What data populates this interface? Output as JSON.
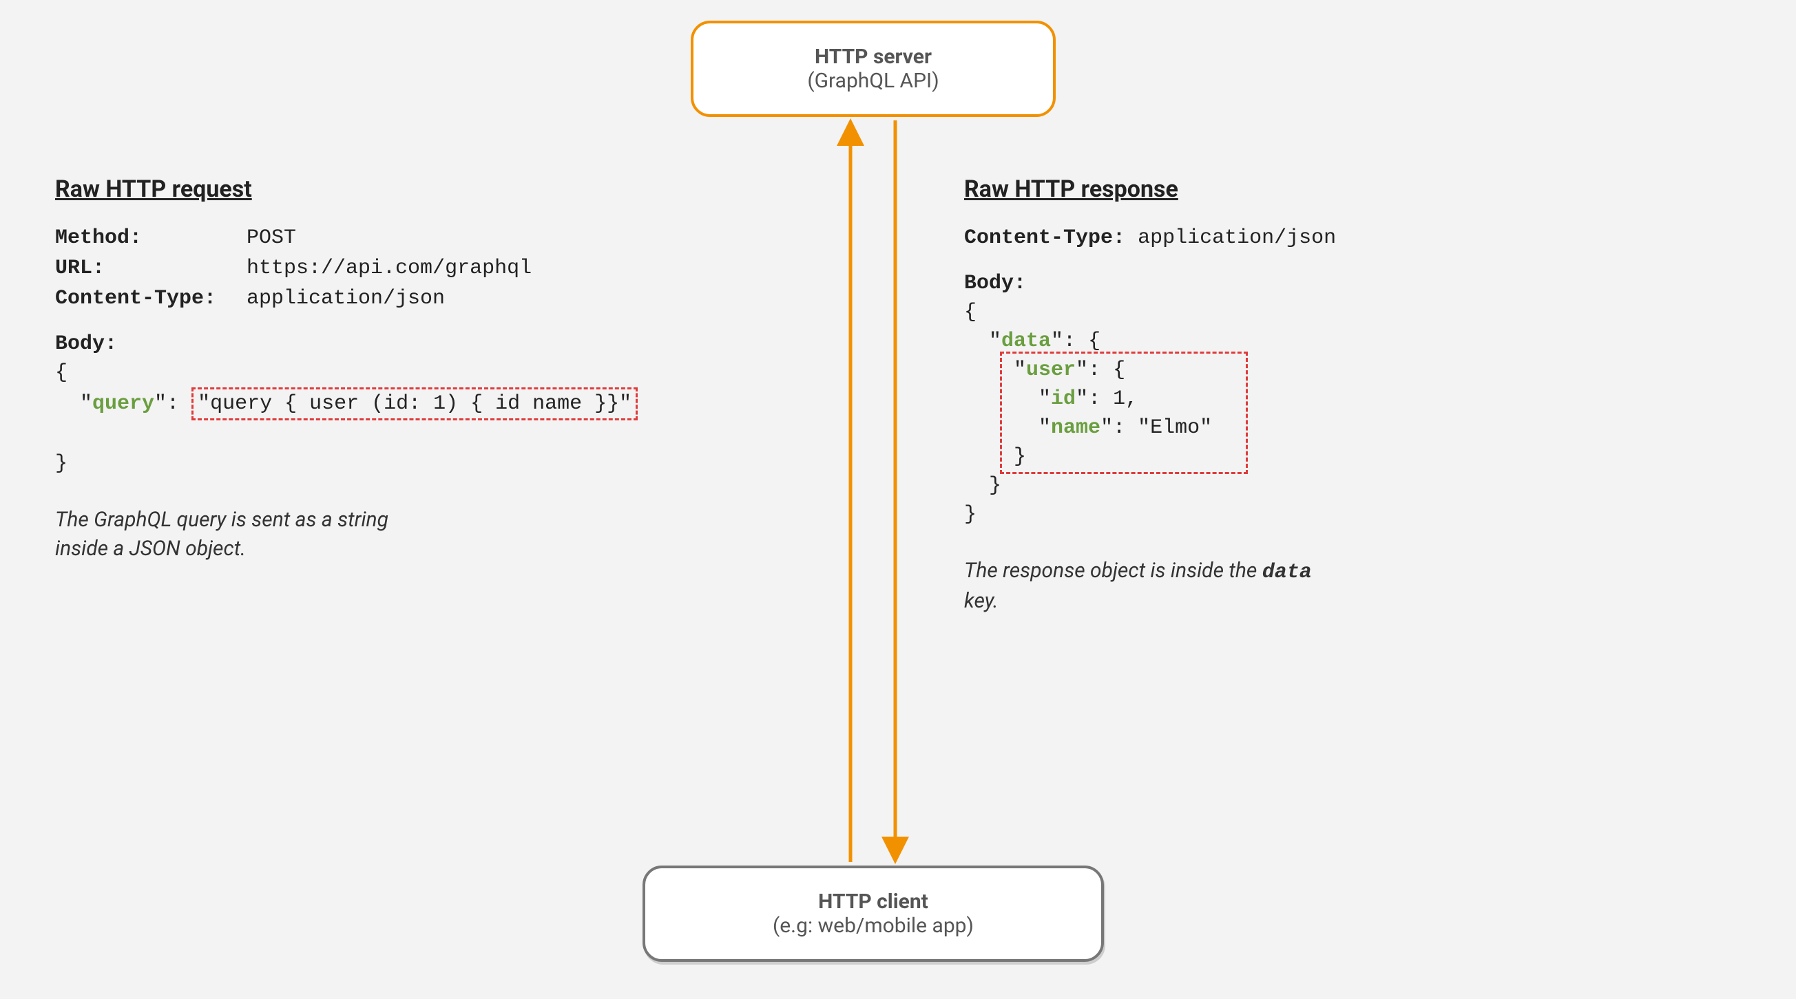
{
  "server": {
    "title": "HTTP server",
    "subtitle": "(GraphQL API)"
  },
  "client": {
    "title": "HTTP client",
    "subtitle": "(e.g: web/mobile app)"
  },
  "request": {
    "heading": "Raw HTTP request",
    "method_label": "Method:",
    "method_value": "POST",
    "url_label": "URL:",
    "url_value": "https://api.com/graphql",
    "ct_label": "Content-Type:",
    "ct_value": "application/json",
    "body_label": "Body:",
    "brace_open": "{",
    "query_key": "query",
    "query_value": "\"query { user (id: 1) { id name }}\"",
    "brace_close": "}",
    "caption_line1": "The GraphQL query is sent as a string",
    "caption_line2": "inside a JSON object."
  },
  "response": {
    "heading": "Raw HTTP response",
    "ct_label": "Content-Type:",
    "ct_value": "application/json",
    "body_label": "Body:",
    "brace_open1": "{",
    "data_key": "data",
    "brace_open2": "{",
    "user_key": "user",
    "brace_open3": "{",
    "id_key": "id",
    "id_val": "1",
    "name_key": "name",
    "name_val": "\"Elmo\"",
    "brace_close3": "}",
    "brace_close2": "}",
    "brace_close1": "}",
    "caption_line1_a": "The response object is inside the ",
    "caption_line1_b": "data",
    "caption_line2": "key."
  }
}
